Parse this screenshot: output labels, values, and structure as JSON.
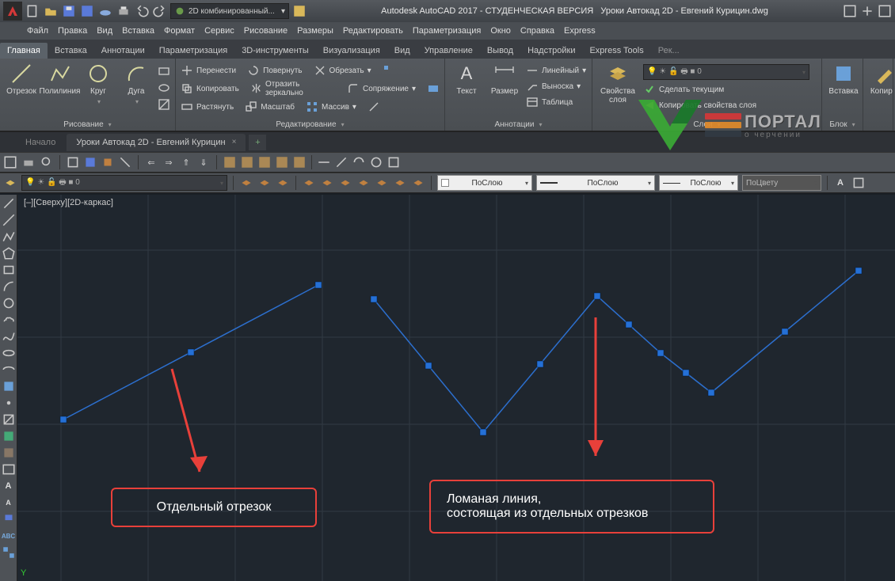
{
  "title": {
    "app": "Autodesk AutoCAD 2017 - СТУДЕНЧЕСКАЯ ВЕРСИЯ",
    "file": "Уроки Автокад 2D - Евгений Курицин.dwg",
    "workspace": "2D комбинированный..."
  },
  "menu": [
    "Файл",
    "Правка",
    "Вид",
    "Вставка",
    "Формат",
    "Сервис",
    "Рисование",
    "Размеры",
    "Редактировать",
    "Параметризация",
    "Окно",
    "Справка",
    "Express"
  ],
  "ribbon_tabs": [
    "Главная",
    "Вставка",
    "Аннотации",
    "Параметризация",
    "3D-инструменты",
    "Визуализация",
    "Вид",
    "Управление",
    "Вывод",
    "Надстройки",
    "Express Tools",
    "Рекомендованные приложения"
  ],
  "ribbon_active": 0,
  "groups": {
    "draw": {
      "label": "Рисование",
      "line": "Отрезок",
      "polyline": "Полилиния",
      "circle": "Круг",
      "arc": "Дуга"
    },
    "modify": {
      "label": "Редактирование",
      "move": "Перенести",
      "copy": "Копировать",
      "stretch": "Растянуть",
      "rotate": "Повернуть",
      "mirror": "Отразить зеркально",
      "scale": "Масштаб",
      "trim": "Обрезать",
      "fillet": "Сопряжение",
      "array": "Массив"
    },
    "annot": {
      "label": "Аннотации",
      "text": "Текст",
      "dim": "Размер",
      "linear": "Линейный",
      "leader": "Выноска",
      "table": "Таблица"
    },
    "layers": {
      "label": "Слои",
      "props": "Свойства\nслоя",
      "make_current": "Сделать текущим",
      "copy_props": "Копировать свойства слоя"
    },
    "block": {
      "label": "Блок",
      "insert": "Вставка"
    },
    "props": {
      "label": "Копир..."
    }
  },
  "doc_tabs": {
    "start": "Начало",
    "active": "Уроки Автокад 2D - Евгений Курицин"
  },
  "prop_dropdowns": {
    "bylayer1": "ПоСлою",
    "bylayer2": "ПоСлою",
    "bylayer3": "ПоСлою",
    "bycolor": "ПоЦвету"
  },
  "canvas": {
    "viewlabel": "[–][Сверху][2D-каркас]",
    "axis_y": "Y",
    "callout1": "Отдельный отрезок",
    "callout2_line1": "Ломаная линия,",
    "callout2_line2": "состоящая из отдельных отрезков"
  },
  "watermark": {
    "main": "ПОРТАЛ",
    "sub": "о черчении"
  },
  "icons": {
    "search": "search-icon",
    "new": "new-icon",
    "open": "open-icon",
    "save": "save-icon",
    "undo": "undo-icon",
    "redo": "redo-icon",
    "print": "print-icon"
  }
}
